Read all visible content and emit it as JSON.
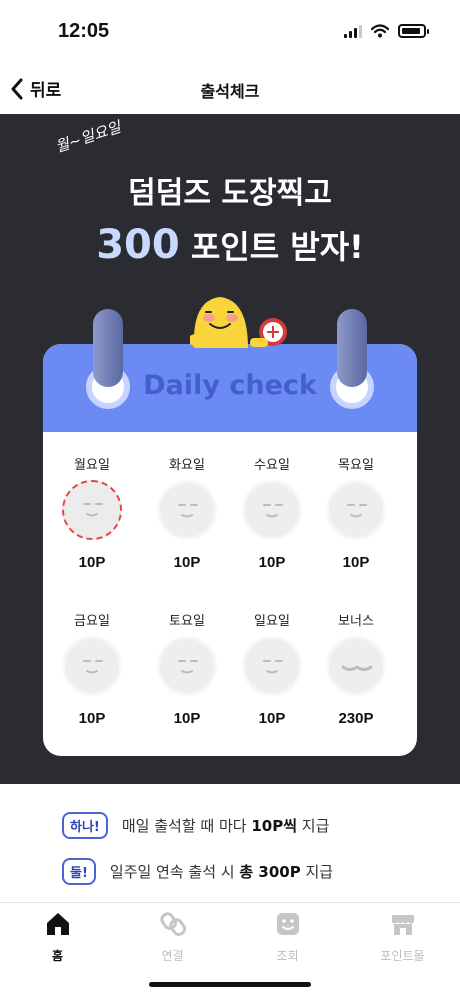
{
  "status_bar": {
    "time": "12:05"
  },
  "header": {
    "back_label": "뒤로",
    "title": "출석체크"
  },
  "hero": {
    "script_text": "월~일요일",
    "headline1": "덤덤즈 도장찍고",
    "headline2_num": "300",
    "headline2_text": "포인트 받자!"
  },
  "calendar": {
    "title": "Daily check",
    "days": [
      {
        "label": "월요일",
        "points": "10P",
        "stamped": true
      },
      {
        "label": "화요일",
        "points": "10P",
        "stamped": false
      },
      {
        "label": "수요일",
        "points": "10P",
        "stamped": false
      },
      {
        "label": "목요일",
        "points": "10P",
        "stamped": false
      },
      {
        "label": "금요일",
        "points": "10P",
        "stamped": false
      },
      {
        "label": "토요일",
        "points": "10P",
        "stamped": false
      },
      {
        "label": "일요일",
        "points": "10P",
        "stamped": false
      },
      {
        "label": "보너스",
        "points": "230P",
        "stamped": false
      }
    ]
  },
  "info": [
    {
      "tag": "하나!",
      "pre": "매일 출석할 때 마다 ",
      "bold": "10P씩",
      "post": " 지급"
    },
    {
      "tag": "둘!",
      "pre": "일주일 연속 출석 시 ",
      "bold": "총 300P",
      "post": " 지급"
    }
  ],
  "tabs": [
    {
      "label": "홈",
      "icon": "home-icon",
      "active": true
    },
    {
      "label": "연결",
      "icon": "link-icon",
      "active": false
    },
    {
      "label": "조회",
      "icon": "smile-icon",
      "active": false
    },
    {
      "label": "포인트몰",
      "icon": "store-icon",
      "active": false
    }
  ],
  "colors": {
    "hero_bg": "#2b2c31",
    "accent": "#6b8af4",
    "tag": "#4b62d6",
    "stamp_active": "#e24a4a"
  }
}
